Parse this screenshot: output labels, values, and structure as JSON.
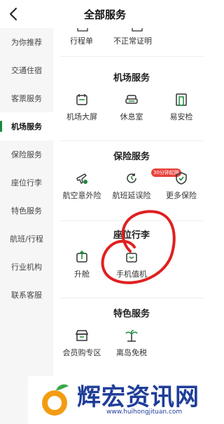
{
  "header": {
    "title": "全部服务"
  },
  "sidebar": {
    "items": [
      {
        "label": "为你推荐"
      },
      {
        "label": "交通住宿"
      },
      {
        "label": "客票服务"
      },
      {
        "label": "机场服务"
      },
      {
        "label": "保险服务"
      },
      {
        "label": "座位行李"
      },
      {
        "label": "特色服务"
      },
      {
        "label": "航班/行程"
      },
      {
        "label": "行业机构"
      },
      {
        "label": "联系客服"
      }
    ],
    "active_index": 3
  },
  "top_partial": {
    "item1": "行程单",
    "item2": "不正常证明"
  },
  "sections": {
    "airport": {
      "title": "机场服务",
      "items": [
        "机场大屏",
        "休息室",
        "易安检"
      ]
    },
    "insurance": {
      "title": "保险服务",
      "items": [
        "航空意外险",
        "航班延误险",
        "更多保险"
      ],
      "badge": "30分钟起赔"
    },
    "seat": {
      "title": "座位行李",
      "items": [
        "升舱",
        "手机值机"
      ]
    },
    "special": {
      "title": "特色服务",
      "items": [
        "会员购专区",
        "离岛免税"
      ]
    }
  },
  "watermark": {
    "text": "辉宏资讯网",
    "url": "www.huihongjituan.com"
  },
  "colors": {
    "accent": "#1a8a3a",
    "badge": "#e8423a",
    "scribble": "#e02020"
  }
}
